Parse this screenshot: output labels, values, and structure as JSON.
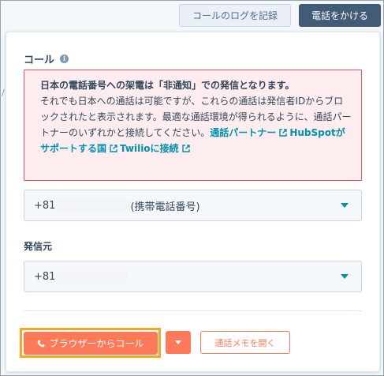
{
  "header": {
    "log_call_label": "コールのログを記録",
    "start_call_label": "電話をかける"
  },
  "panel": {
    "title": "コール",
    "title_icon": "info-icon",
    "alert": {
      "heading": "日本の電話番号への架電は「非通知」での発信となります。",
      "body": "それでも日本への通話は可能ですが、これらの通話は発信者IDからブロックされたと表示されます。最適な通話環境が得られるように、通話パートナーのいずれかと接続してください。",
      "links": [
        {
          "label": "通話パートナー",
          "icon": "external-link-icon"
        },
        {
          "label": "HubSpotがサポートする国",
          "icon": "external-link-icon"
        },
        {
          "label": "Twilioに接続",
          "icon": "external-link-icon"
        }
      ]
    },
    "to_number": {
      "prefix": "+81",
      "type_label": "(携帯電話番号)"
    },
    "from_label": "発信元",
    "from_number": {
      "prefix": "+81"
    },
    "actions": {
      "browser_call_label": "ブラウザーからコール",
      "open_notes_label": "通話メモを開く"
    }
  },
  "colors": {
    "primary_dark": "#425b76",
    "accent_orange": "#ff7a59",
    "highlight_border": "#f5a623",
    "alert_border": "#f2545b",
    "alert_bg": "#fdedee",
    "link": "#0091ae"
  }
}
